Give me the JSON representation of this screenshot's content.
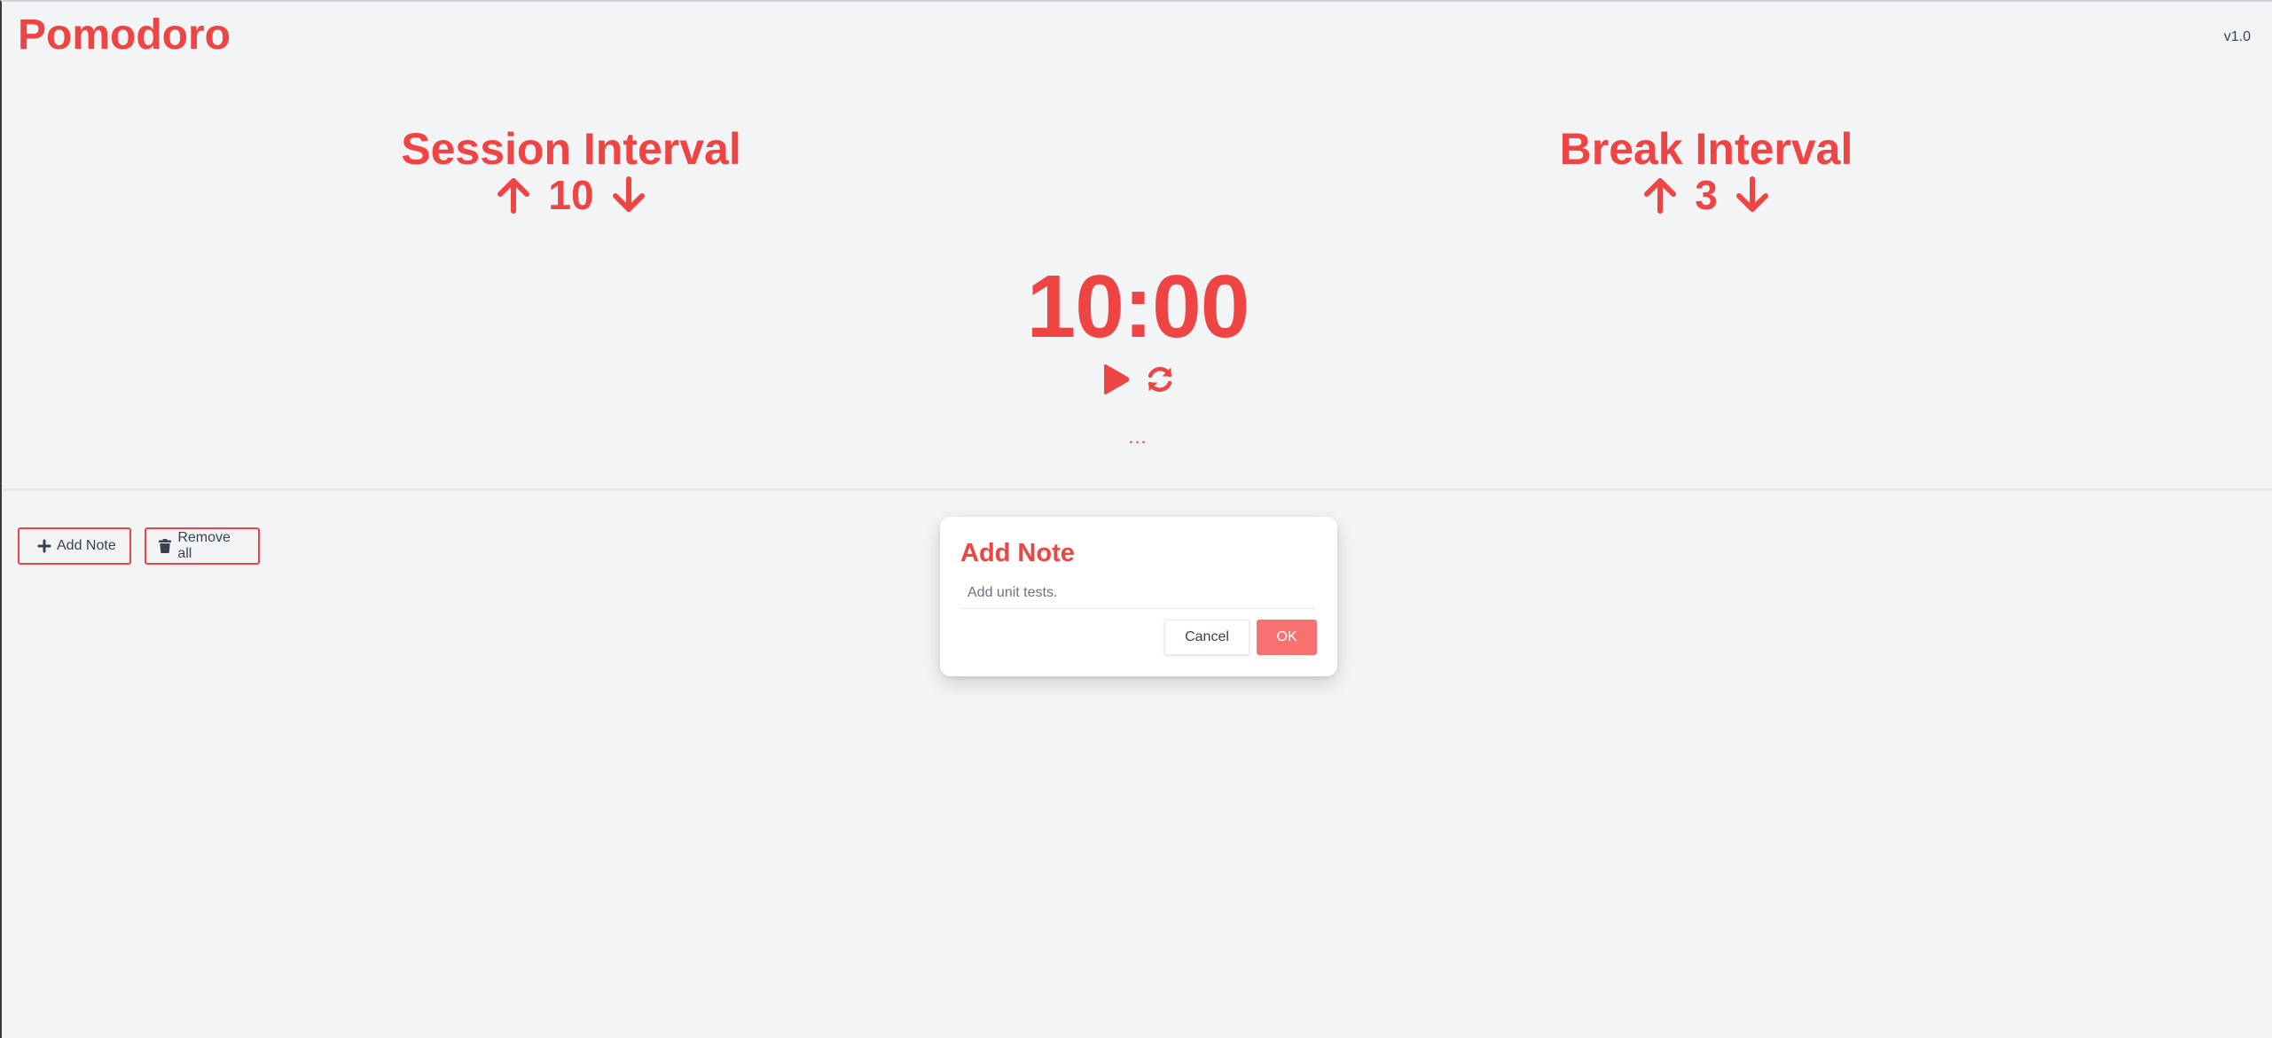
{
  "header": {
    "app_title": "Pomodoro",
    "version": "v1.0"
  },
  "session": {
    "title": "Session Interval",
    "value": "10"
  },
  "break_interval": {
    "title": "Break Interval",
    "value": "3"
  },
  "timer": {
    "display": "10:00",
    "status": "..."
  },
  "toolbar": {
    "add_note_label": "Add Note",
    "remove_all_label": "Remove all"
  },
  "modal": {
    "title": "Add Note",
    "input_value": "",
    "input_placeholder": "Add unit tests.",
    "cancel_label": "Cancel",
    "ok_label": "OK"
  },
  "colors": {
    "accent": "#ef4444",
    "accent_light": "#f87171",
    "background": "#f3f4f6",
    "text_dark": "#374151"
  },
  "icons": {
    "increment": "arrow-up-icon",
    "decrement": "arrow-down-icon",
    "play": "play-icon",
    "reset": "refresh-icon",
    "add": "plus-icon",
    "remove": "trash-icon"
  }
}
